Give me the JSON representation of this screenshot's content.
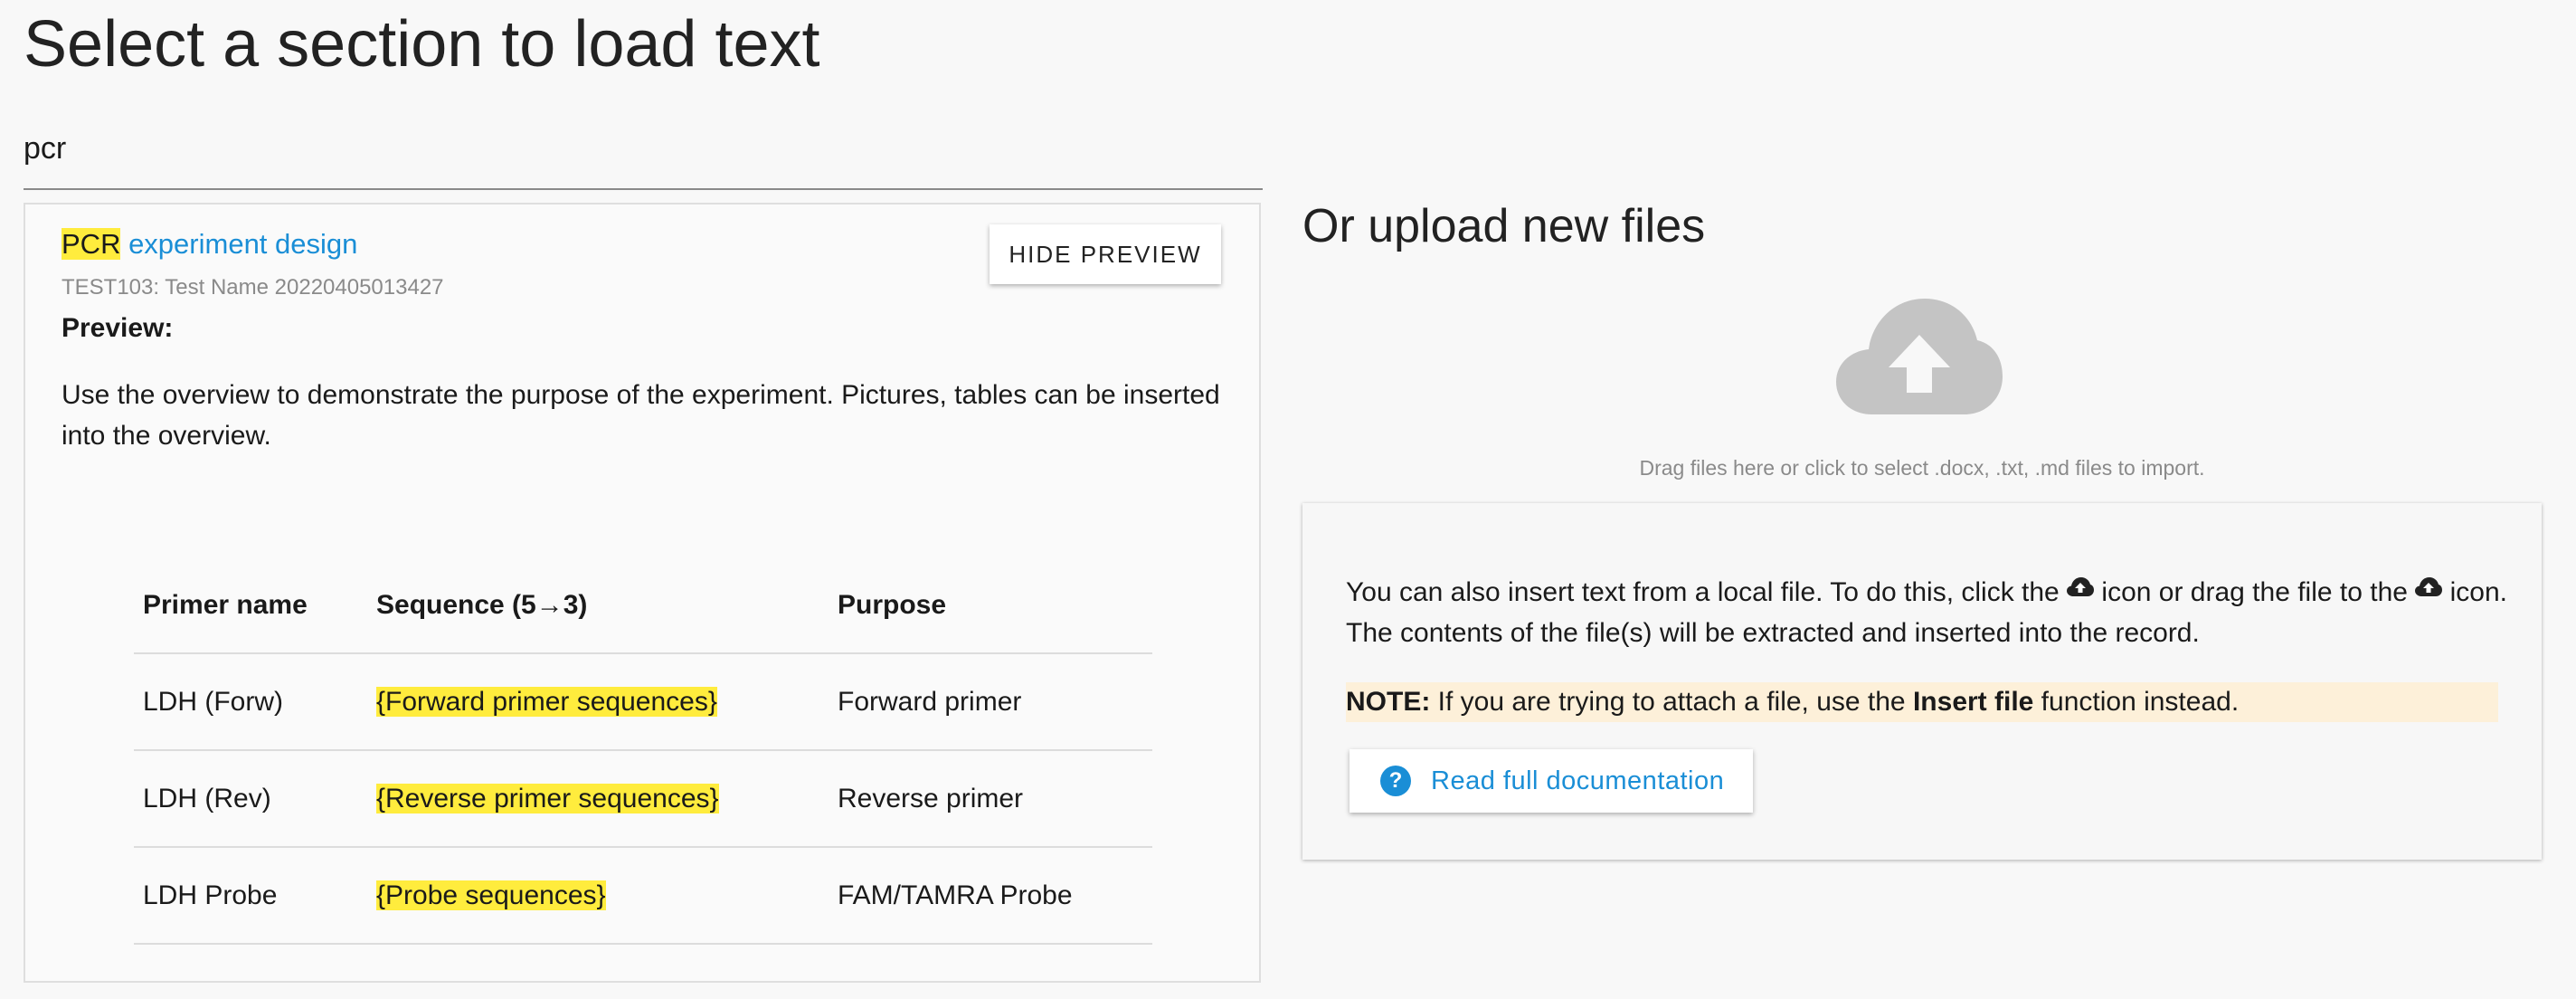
{
  "page": {
    "title": "Select a section to load text"
  },
  "search": {
    "value": "pcr"
  },
  "result": {
    "title_highlight": "PCR",
    "title_rest": " experiment design",
    "subtitle": "TEST103: Test Name 20220405013427",
    "hide_preview_label": "HIDE PREVIEW",
    "preview_label": "Preview:",
    "preview_text": "Use the overview to demonstrate the purpose of the experiment. Pictures, tables can be inserted into the overview.",
    "table": {
      "headers": [
        "Primer name",
        "Sequence (5→3)",
        "Purpose"
      ],
      "rows": [
        [
          "LDH (Forw)",
          "{Forward primer sequences}",
          "Forward primer"
        ],
        [
          "LDH (Rev)",
          "{Reverse primer sequences}",
          "Reverse primer"
        ],
        [
          "LDH Probe",
          "{Probe sequences}",
          "FAM/TAMRA Probe"
        ]
      ]
    }
  },
  "upload": {
    "title": "Or upload new files",
    "icon": "cloud-upload-icon",
    "dropzone_text": "Drag files here or click to select .docx, .txt, .md files to import.",
    "info_part1": "You can also insert text from a local file. To do this, click the ",
    "info_part2": " icon or drag the file to the ",
    "info_part3": " icon. The contents of the file(s) will be extracted and inserted into the record.",
    "note_label": "NOTE:",
    "note_part1": " If you are trying to attach a file, use the ",
    "note_bold": "Insert file",
    "note_part2": " function instead.",
    "doc_button_label": "Read full documentation"
  },
  "colors": {
    "highlight": "#ffec3d",
    "link": "#1a8ed6",
    "note_bg": "#fdf0d9",
    "cloud": "#c4c4c4"
  }
}
